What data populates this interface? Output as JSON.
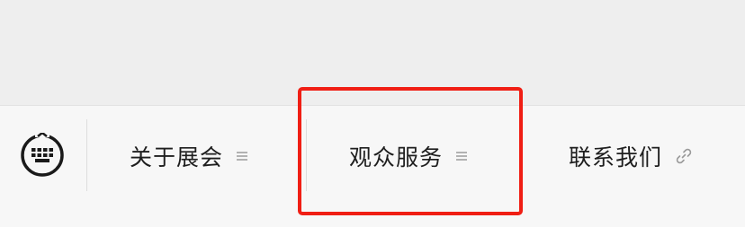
{
  "nav": {
    "keyboard_icon": "keyboard-icon",
    "items": [
      {
        "label": "关于展会",
        "icon": "menu-lines-icon"
      },
      {
        "label": "观众服务",
        "icon": "menu-lines-icon"
      },
      {
        "label": "联系我们",
        "icon": "link-icon"
      }
    ]
  },
  "highlight": {
    "color": "#f01e14"
  },
  "colors": {
    "text": "#1e1e1e",
    "icon_gray": "#9a9a9a",
    "bar_background": "#f7f7f7",
    "top_background": "#eeeeee"
  }
}
